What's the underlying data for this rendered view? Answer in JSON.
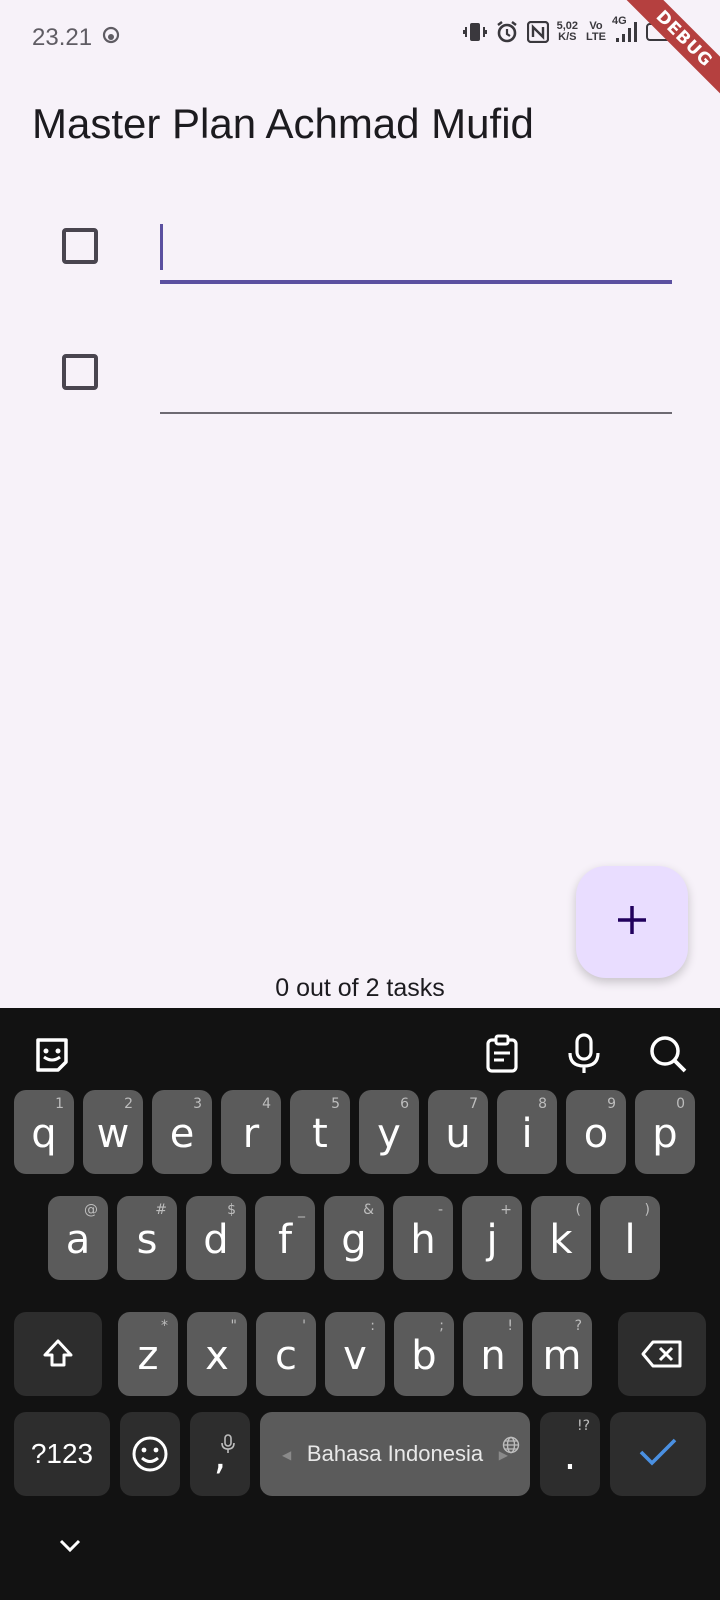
{
  "status_bar": {
    "time": "23.21",
    "network_speed_value": "5,02",
    "network_speed_unit": "K/S",
    "volte_top": "Vo",
    "volte_bottom": "LTE",
    "network_type": "4G",
    "icons": [
      "face-icon",
      "vibrate-icon",
      "alarm-icon",
      "nfc-icon",
      "signal-icon",
      "battery-icon"
    ]
  },
  "debug_banner": "DEBUG",
  "app": {
    "title": "Master Plan Achmad Mufid"
  },
  "tasks": [
    {
      "checked": false,
      "description": "",
      "focused": true
    },
    {
      "checked": false,
      "description": "",
      "focused": false
    }
  ],
  "fab": {
    "icon": "add-icon"
  },
  "footer": {
    "task_count": "0 out of 2 tasks"
  },
  "keyboard": {
    "toolbar_icons": [
      "emoji-sticker-icon",
      "clipboard-icon",
      "microphone-icon",
      "search-icon"
    ],
    "row1": [
      {
        "key": "q",
        "hint": "1"
      },
      {
        "key": "w",
        "hint": "2"
      },
      {
        "key": "e",
        "hint": "3"
      },
      {
        "key": "r",
        "hint": "4"
      },
      {
        "key": "t",
        "hint": "5"
      },
      {
        "key": "y",
        "hint": "6"
      },
      {
        "key": "u",
        "hint": "7"
      },
      {
        "key": "i",
        "hint": "8"
      },
      {
        "key": "o",
        "hint": "9"
      },
      {
        "key": "p",
        "hint": "0"
      }
    ],
    "row2": [
      {
        "key": "a",
        "hint": "@"
      },
      {
        "key": "s",
        "hint": "#"
      },
      {
        "key": "d",
        "hint": "$"
      },
      {
        "key": "f",
        "hint": "_"
      },
      {
        "key": "g",
        "hint": "&"
      },
      {
        "key": "h",
        "hint": "-"
      },
      {
        "key": "j",
        "hint": "+"
      },
      {
        "key": "k",
        "hint": "("
      },
      {
        "key": "l",
        "hint": ")"
      }
    ],
    "row3": [
      {
        "key": "z",
        "hint": "*"
      },
      {
        "key": "x",
        "hint": "\""
      },
      {
        "key": "c",
        "hint": "'"
      },
      {
        "key": "v",
        "hint": ":"
      },
      {
        "key": "b",
        "hint": ";"
      },
      {
        "key": "n",
        "hint": "!"
      },
      {
        "key": "m",
        "hint": "?"
      }
    ],
    "symbols_key": "?123",
    "comma_key": ",",
    "space_label": "Bahasa Indonesia",
    "period_key": ".",
    "period_hint": "!?",
    "accent_color": "#4a90e2"
  }
}
